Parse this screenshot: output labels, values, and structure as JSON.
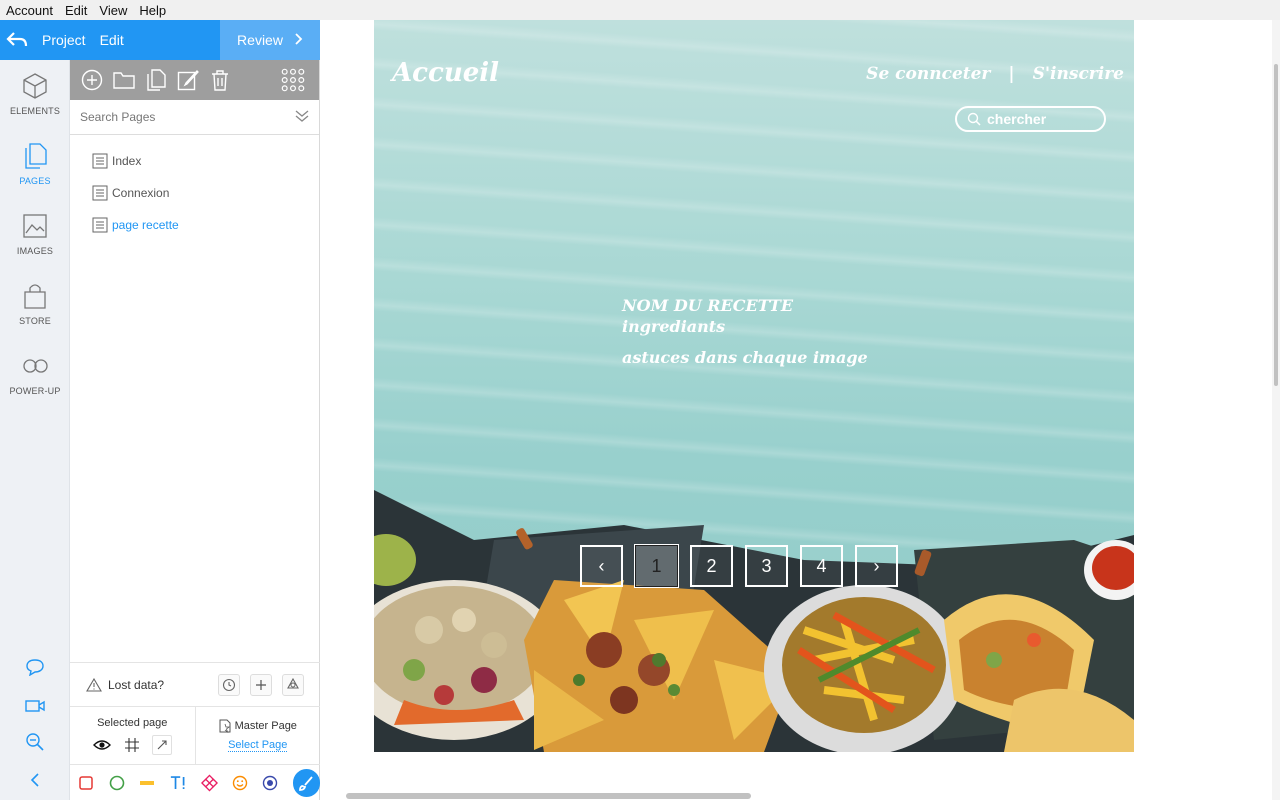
{
  "menubar": {
    "items": [
      "Account",
      "Edit",
      "View",
      "Help"
    ]
  },
  "topbar": {
    "project_label": "Project",
    "edit_label": "Edit",
    "review_label": "Review"
  },
  "rail": {
    "items": [
      {
        "label": "ELEMENTS",
        "icon": "cube-icon"
      },
      {
        "label": "PAGES",
        "icon": "pages-icon"
      },
      {
        "label": "IMAGES",
        "icon": "image-icon"
      },
      {
        "label": "STORE",
        "icon": "bag-icon"
      },
      {
        "label": "POWER-UP",
        "icon": "infinity-icon"
      }
    ],
    "active": "PAGES"
  },
  "pages_panel": {
    "search_placeholder": "Search Pages",
    "pages": [
      "Index",
      "Connexion",
      "page recette"
    ],
    "selected": "page recette",
    "lost_data_label": "Lost data?",
    "selected_page_label": "Selected page",
    "master_page_label": "Master Page",
    "select_page_link": "Select Page"
  },
  "site": {
    "title": "Accueil",
    "nav_login": "Se connceter",
    "nav_sep": "|",
    "nav_signup": "S'inscrire",
    "search_placeholder": "chercher",
    "recipe_name": "NOM DU RECETTE",
    "ingredients": "ingrediants",
    "tips": "astuces dans chaque image",
    "pager": {
      "prev": "‹",
      "pages": [
        "1",
        "2",
        "3",
        "4"
      ],
      "active": "1",
      "next": "›"
    }
  },
  "colors": {
    "accent": "#2196f3",
    "canvas_bg": "#a9d8d4"
  }
}
